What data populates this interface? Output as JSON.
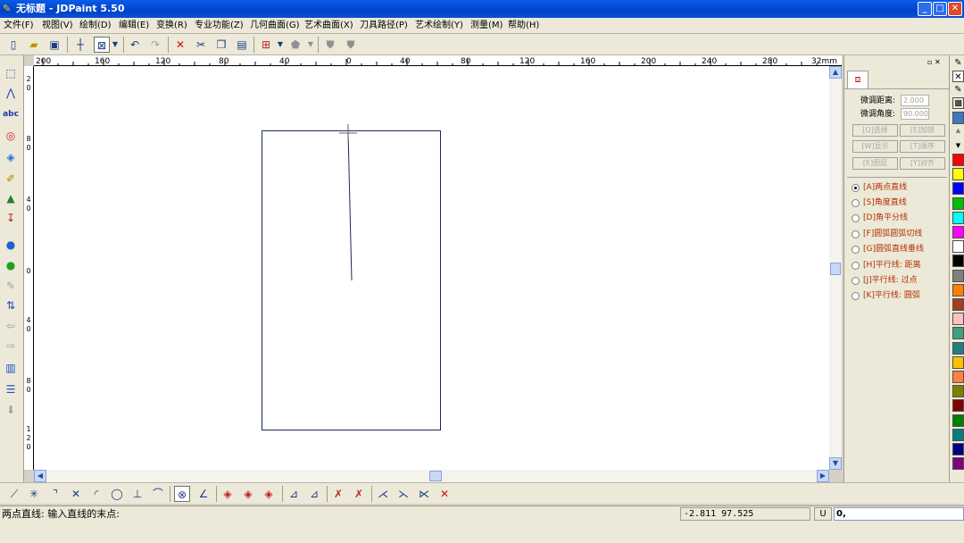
{
  "window": {
    "title": "无标题 - JDPaint 5.50"
  },
  "menu": [
    "文件(F)",
    "视图(V)",
    "绘制(D)",
    "编辑(E)",
    "变换(R)",
    "专业功能(Z)",
    "几何曲面(G)",
    "艺术曲面(X)",
    "刀具路径(P)",
    "艺术绘制(Y)",
    "测量(M)",
    "帮助(H)"
  ],
  "ruler": {
    "h_labels": [
      "200",
      "160",
      "120",
      "80",
      "40",
      "0",
      "40",
      "80",
      "120",
      "160",
      "200",
      "240",
      "280",
      "32mm"
    ],
    "v_labels": [
      "2 0",
      "8 0",
      "4 0",
      "0",
      "4 0",
      "8 0",
      "1 2 0"
    ]
  },
  "panel": {
    "tab_icon": "rect-select-icon",
    "nudge_distance_label": "微调距离:",
    "nudge_distance_value": "2.000",
    "nudge_angle_label": "微调角度:",
    "nudge_angle_value": "90.000",
    "buttons": [
      "[Q]选择",
      "[E]加锁",
      "[W]显示",
      "[T]顺序",
      "[E]图层",
      "[Y]对齐"
    ],
    "options": [
      {
        "label": "[A]两点直线",
        "selected": true
      },
      {
        "label": "[S]角度直线",
        "selected": false
      },
      {
        "label": "[D]角平分线",
        "selected": false
      },
      {
        "label": "[F]圆弧圆弧切线",
        "selected": false
      },
      {
        "label": "[G]圆弧直线垂线",
        "selected": false
      },
      {
        "label": "[H]平行线: 距离",
        "selected": false
      },
      {
        "label": "[J]平行线: 过点",
        "selected": false
      },
      {
        "label": "[K]平行线: 圆弧",
        "selected": false
      }
    ]
  },
  "palette": {
    "colors": [
      "#ff0000",
      "#ffff00",
      "#0000ff",
      "#00c000",
      "#00ffff",
      "#ff00ff",
      "#ffffff",
      "#000000",
      "#808080",
      "#ff8000",
      "#a04020",
      "#ffc0c0",
      "#40a080",
      "#208080",
      "#ffc000",
      "#ff8040",
      "#808000",
      "#800000",
      "#008000",
      "#008080",
      "#000080",
      "#800080",
      "#404040"
    ]
  },
  "status": {
    "prompt": "两点直线: 输入直线的末点:",
    "coords": "-2.811  97.525",
    "unit": "U",
    "input": "0,"
  }
}
